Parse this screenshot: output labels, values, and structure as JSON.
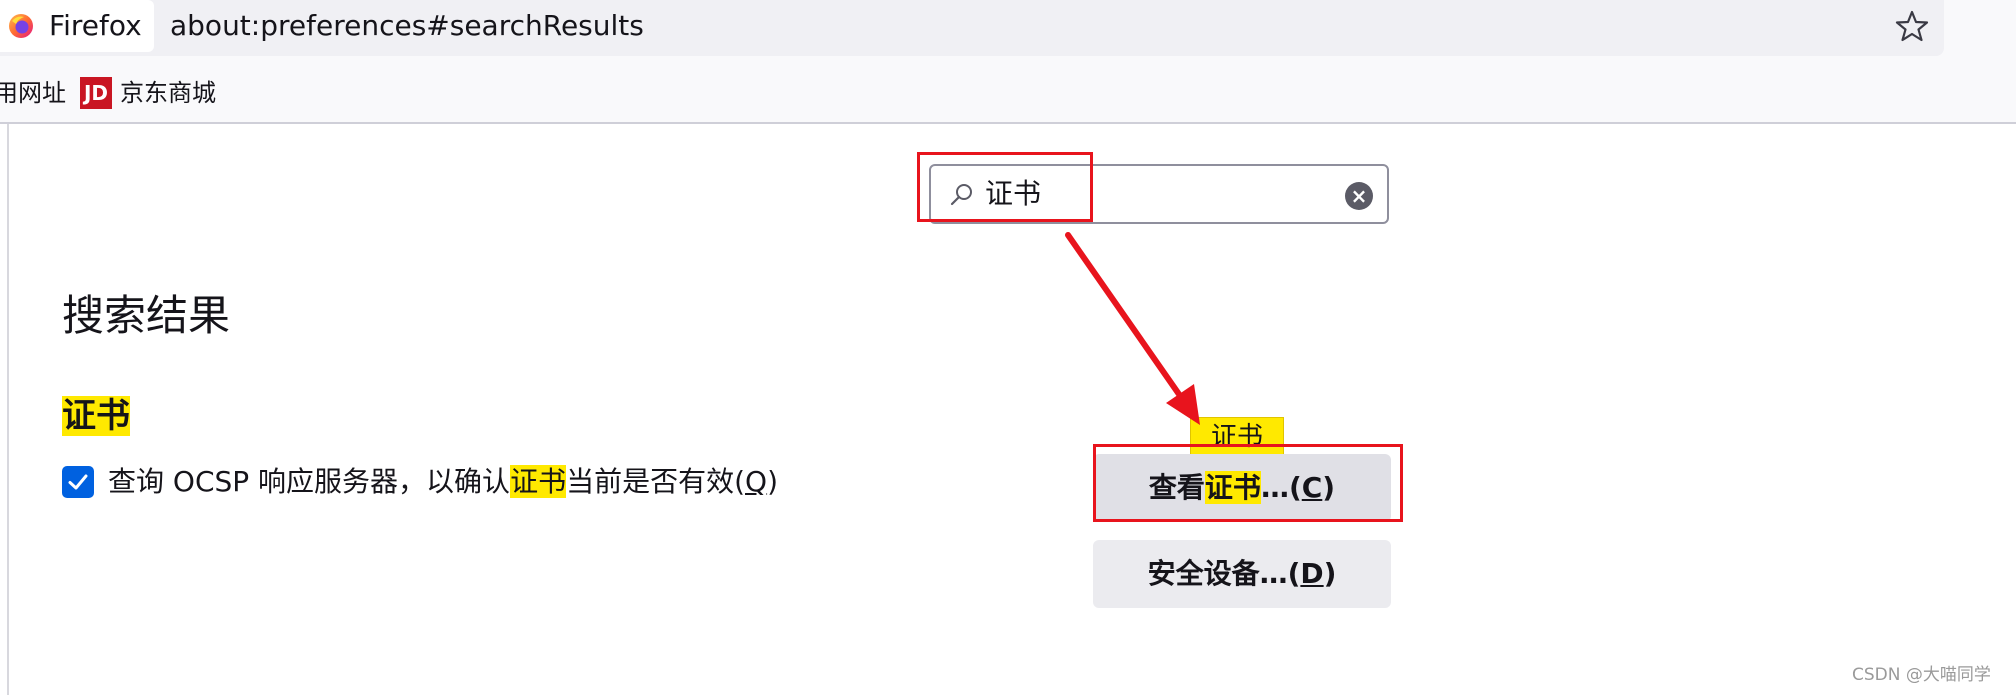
{
  "browser": {
    "identity_label": "Firefox",
    "url": "about:preferences#searchResults"
  },
  "bookmarks": {
    "first_label": "用网址",
    "jd_icon_text": "JD",
    "jd_label": "京东商城"
  },
  "search": {
    "value": "证书",
    "clear_icon": "×"
  },
  "results": {
    "heading": "搜索结果",
    "group_title": "证书",
    "ocsp": {
      "prefix": "查询 OCSP 响应服务器，以确认",
      "highlight": "证书",
      "suffix": "当前是否有效(",
      "accesskey": "Q",
      "close": ")",
      "checked": true
    }
  },
  "tooltip": {
    "label": "证书"
  },
  "buttons": {
    "view_cert": {
      "prefix": "查看",
      "highlight": "证书",
      "suffix": "…(",
      "accesskey": "C",
      "close": ")"
    },
    "security_devices": {
      "prefix": "安全设备…(",
      "accesskey": "D",
      "close": ")"
    }
  },
  "watermark": "CSDN @大喵同学",
  "colors": {
    "highlight": "#ffe900",
    "annotation": "#e8141d",
    "checkbox": "#0061e0"
  }
}
